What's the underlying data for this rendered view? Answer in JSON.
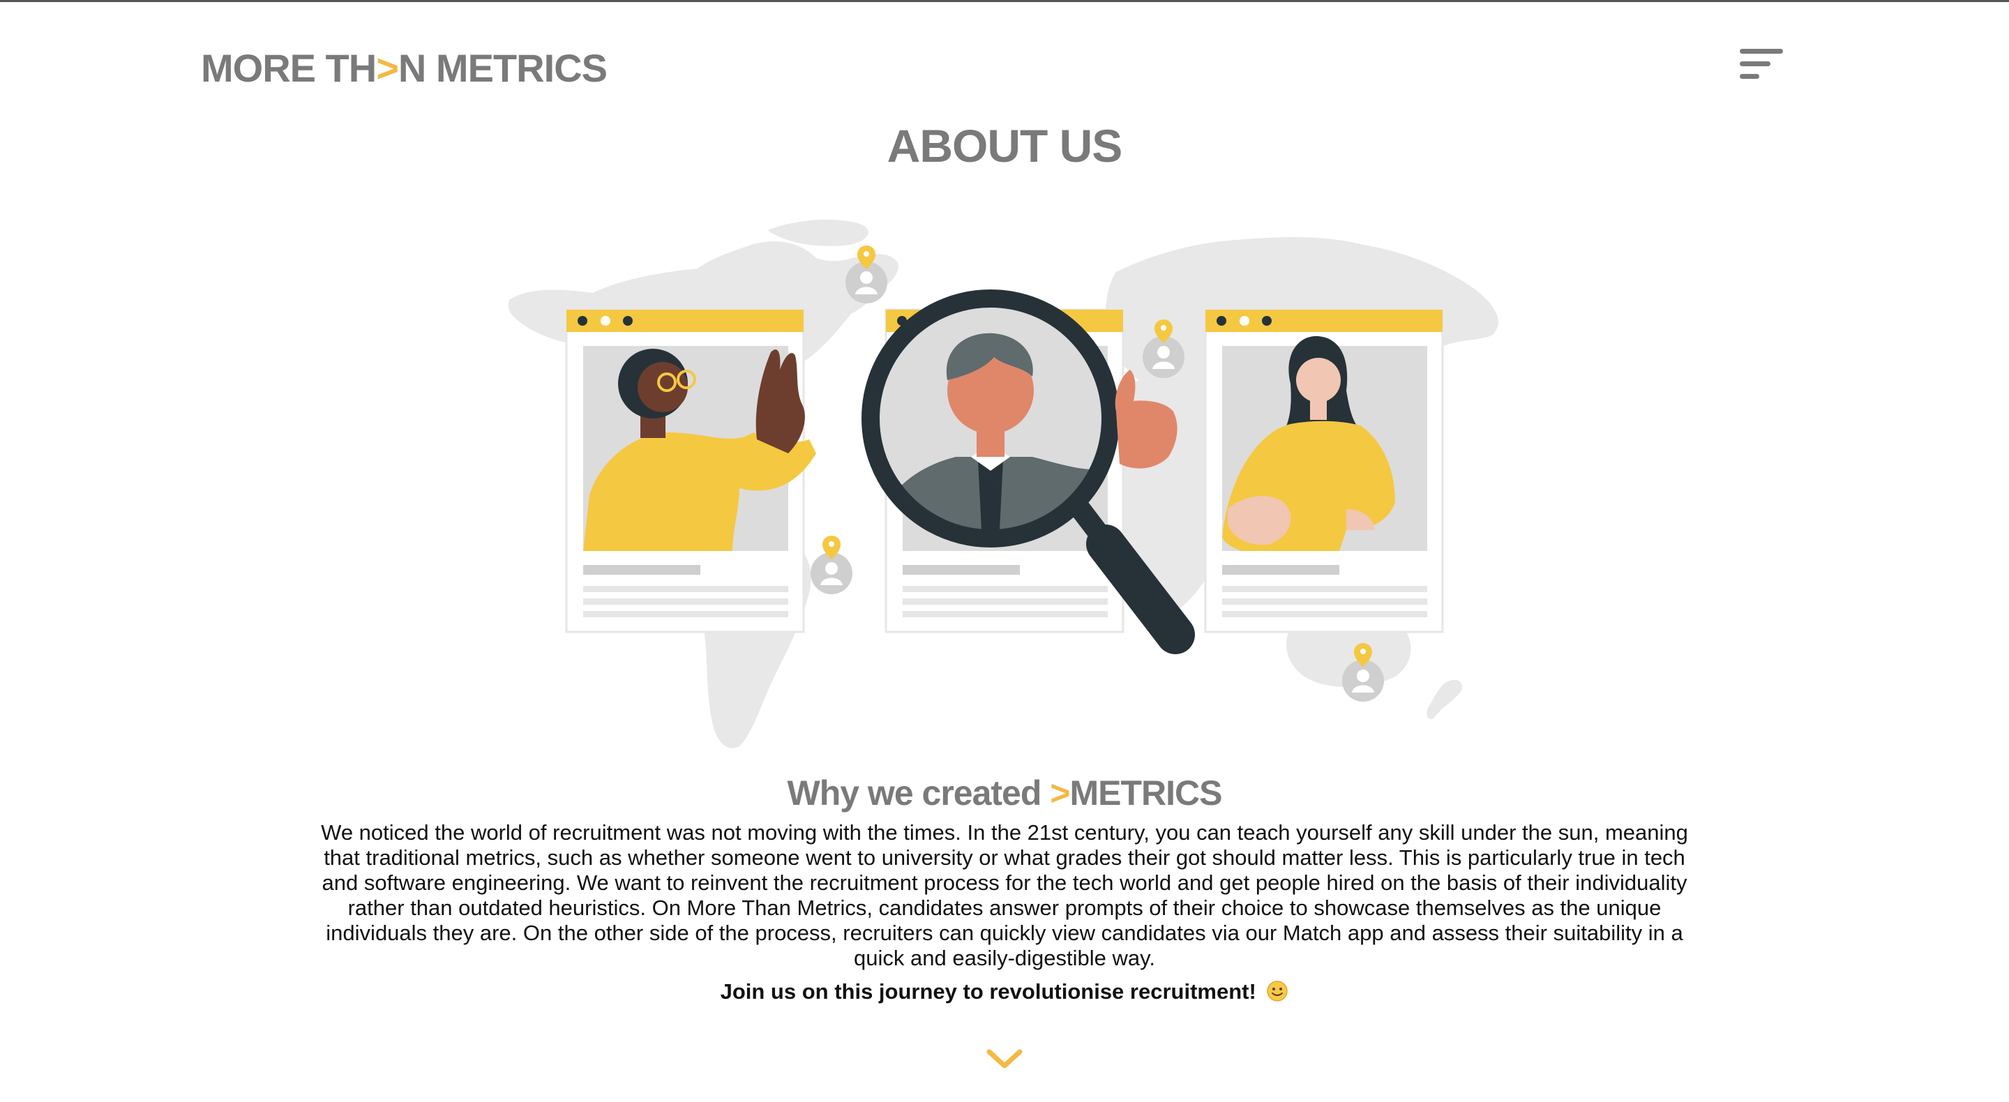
{
  "header": {
    "logo_part1": "MORE TH",
    "logo_accent": ">",
    "logo_part2": "N METRICS",
    "menu_icon": "hamburger-menu-icon"
  },
  "page": {
    "title": "ABOUT US"
  },
  "section": {
    "heading_part1": "Why we created ",
    "heading_accent": ">",
    "heading_part2": "METRICS",
    "body": "We noticed the world of recruitment was not moving with the times. In the 21st century, you can teach yourself any skill under the sun, meaning that traditional metrics, such as whether someone went to university or what grades their got should matter less. This is particularly true in tech and software engineering. We want to reinvent the recruitment process for the tech world and get people hired on the basis of their individuality rather than outdated heuristics. On More Than Metrics, candidates answer prompts of their choice to showcase themselves as the unique individuals they are. On the other side of the process, recruiters can quickly view candidates via our Match app and assess their suitability in a quick and easily-digestible way.",
    "cta": "Join us on this journey to revolutionise recruitment!",
    "cta_emoji": "slightly-smiling-face-icon"
  },
  "scroll": {
    "icon": "chevron-down-icon"
  },
  "colors": {
    "accent": "#f4b844",
    "text_gray": "#7a7a7a",
    "body_text": "#111111",
    "map_gray": "#e6e6e6",
    "card_yellow": "#f5c842",
    "magnifier_dark": "#263238"
  }
}
